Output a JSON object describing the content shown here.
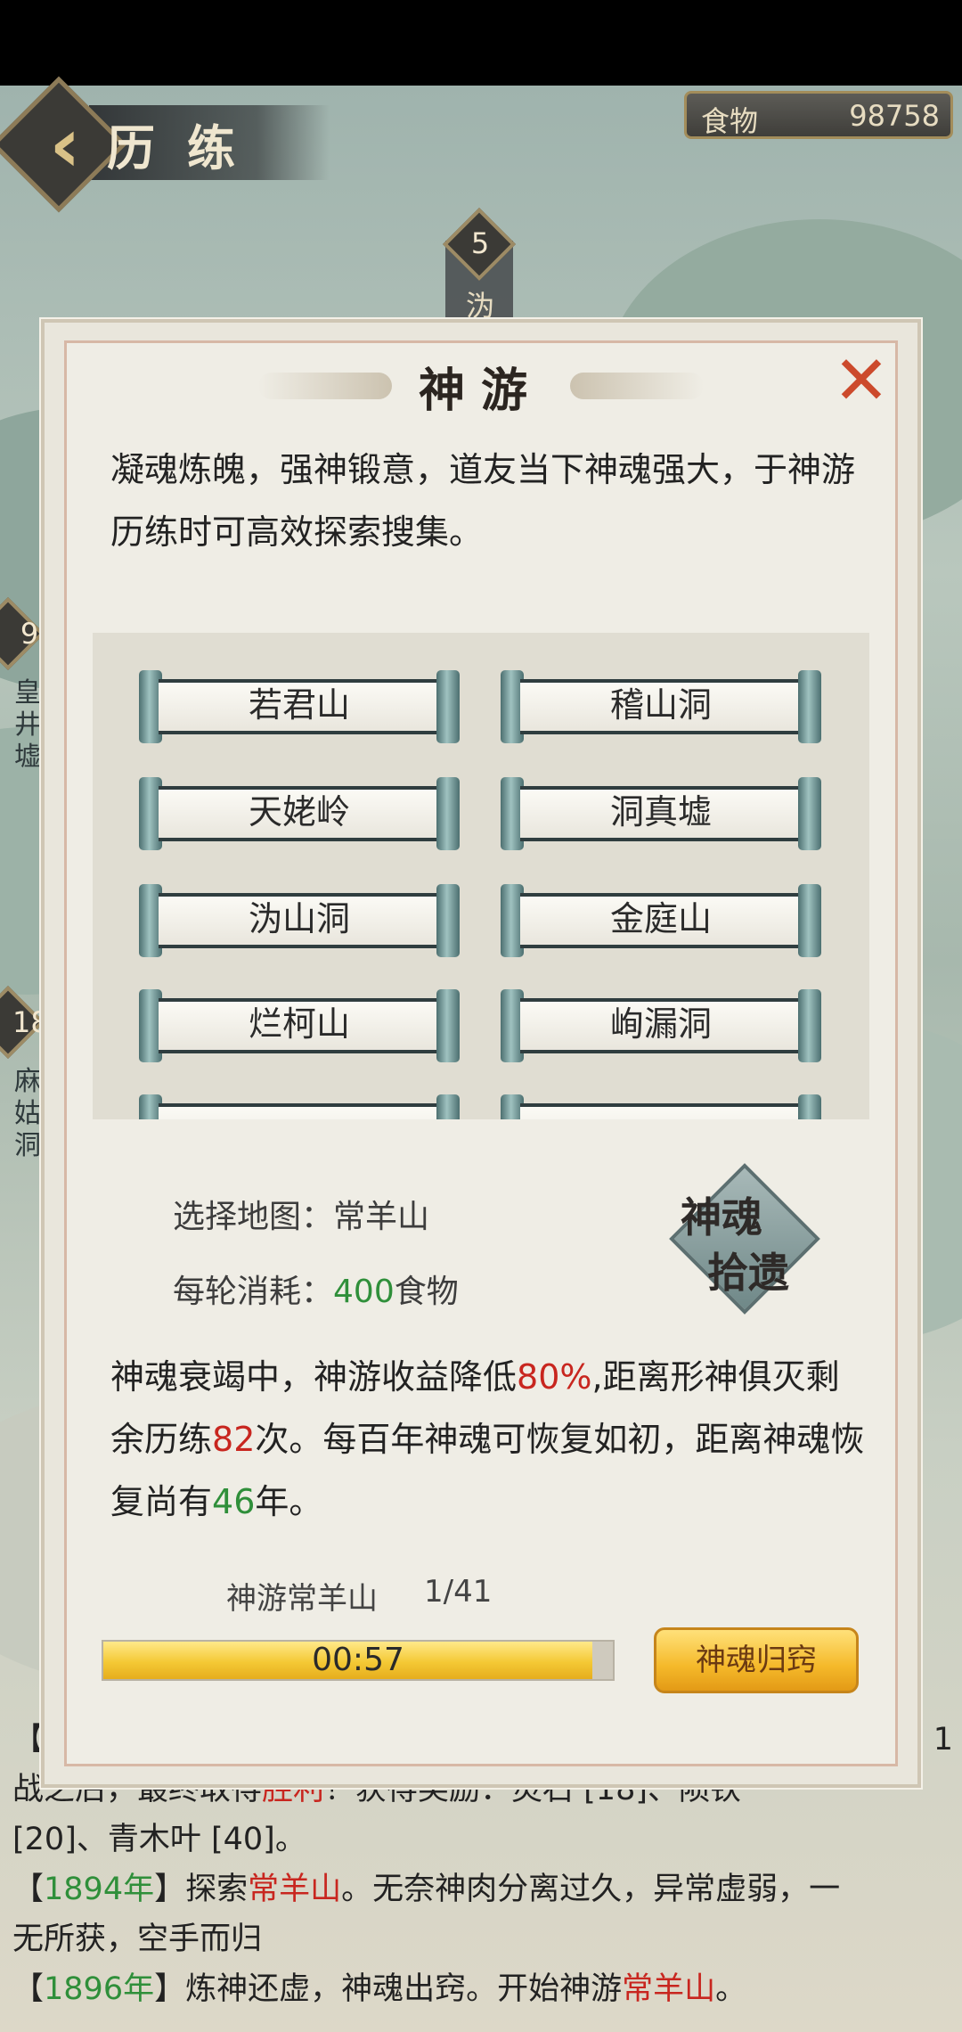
{
  "header": {
    "title": "历练",
    "food_label": "食物",
    "food_value": "98758"
  },
  "map_nodes": {
    "node_5_number": "5",
    "node_5_name": "沩",
    "node_9_number": "9",
    "node_9_name": "皇井墟",
    "node_18_number": "18",
    "node_18_name": "麻姑洞"
  },
  "dialog": {
    "title": "神游",
    "close": "✕",
    "intro": "凝魂炼魄，强神锻意，道友当下神魂强大，于神游历练时可高效探索搜集。",
    "maps": [
      "若君山",
      "稽山洞",
      "天姥岭",
      "洞真墟",
      "沩山洞",
      "金庭山",
      "烂柯山",
      "峋漏洞"
    ],
    "selected_label": "选择地图：",
    "selected_map": "常羊山",
    "cost_label": "每轮消耗：",
    "cost_value": "400",
    "cost_unit": "食物",
    "seal_line1": "神魂",
    "seal_line2": "拾遗",
    "status": {
      "p1": "神魂衰竭中，神游收益降低",
      "pct": "80%",
      "p2": ",距离形神俱灭剩余历练",
      "times": "82",
      "p3": "次。每百年神魂可恢复如初，距离神魂恢复尚有",
      "years": "46",
      "p4": "年。"
    },
    "progress_title": "神游常羊山",
    "progress_count": "1/41",
    "progress_time": "00:57",
    "progress_fraction": 0.96,
    "return_button": "神魂归窍"
  },
  "log": {
    "l1_a": "【",
    "l1_b": "1",
    "l2_a": "战之后，最终取得",
    "l2_win": "胜利",
    "l2_b": "！获得奖励：灵石 [18]、陨铁",
    "l3": "[20]、青木叶 [40]。",
    "l4_year": "1894年",
    "l4_a": "探索",
    "l4_place": "常羊山",
    "l4_b": "。无奈神肉分离过久，异常虚弱，一",
    "l5": "无所获，空手而归",
    "l6_year": "1896年",
    "l6_a": "炼神还虚，神魂出窍。开始神游",
    "l6_place": "常羊山",
    "l6_b": "。"
  },
  "colors": {
    "accent_green": "#2f8f3a",
    "accent_red": "#c8261f",
    "gold": "#f4c935"
  }
}
